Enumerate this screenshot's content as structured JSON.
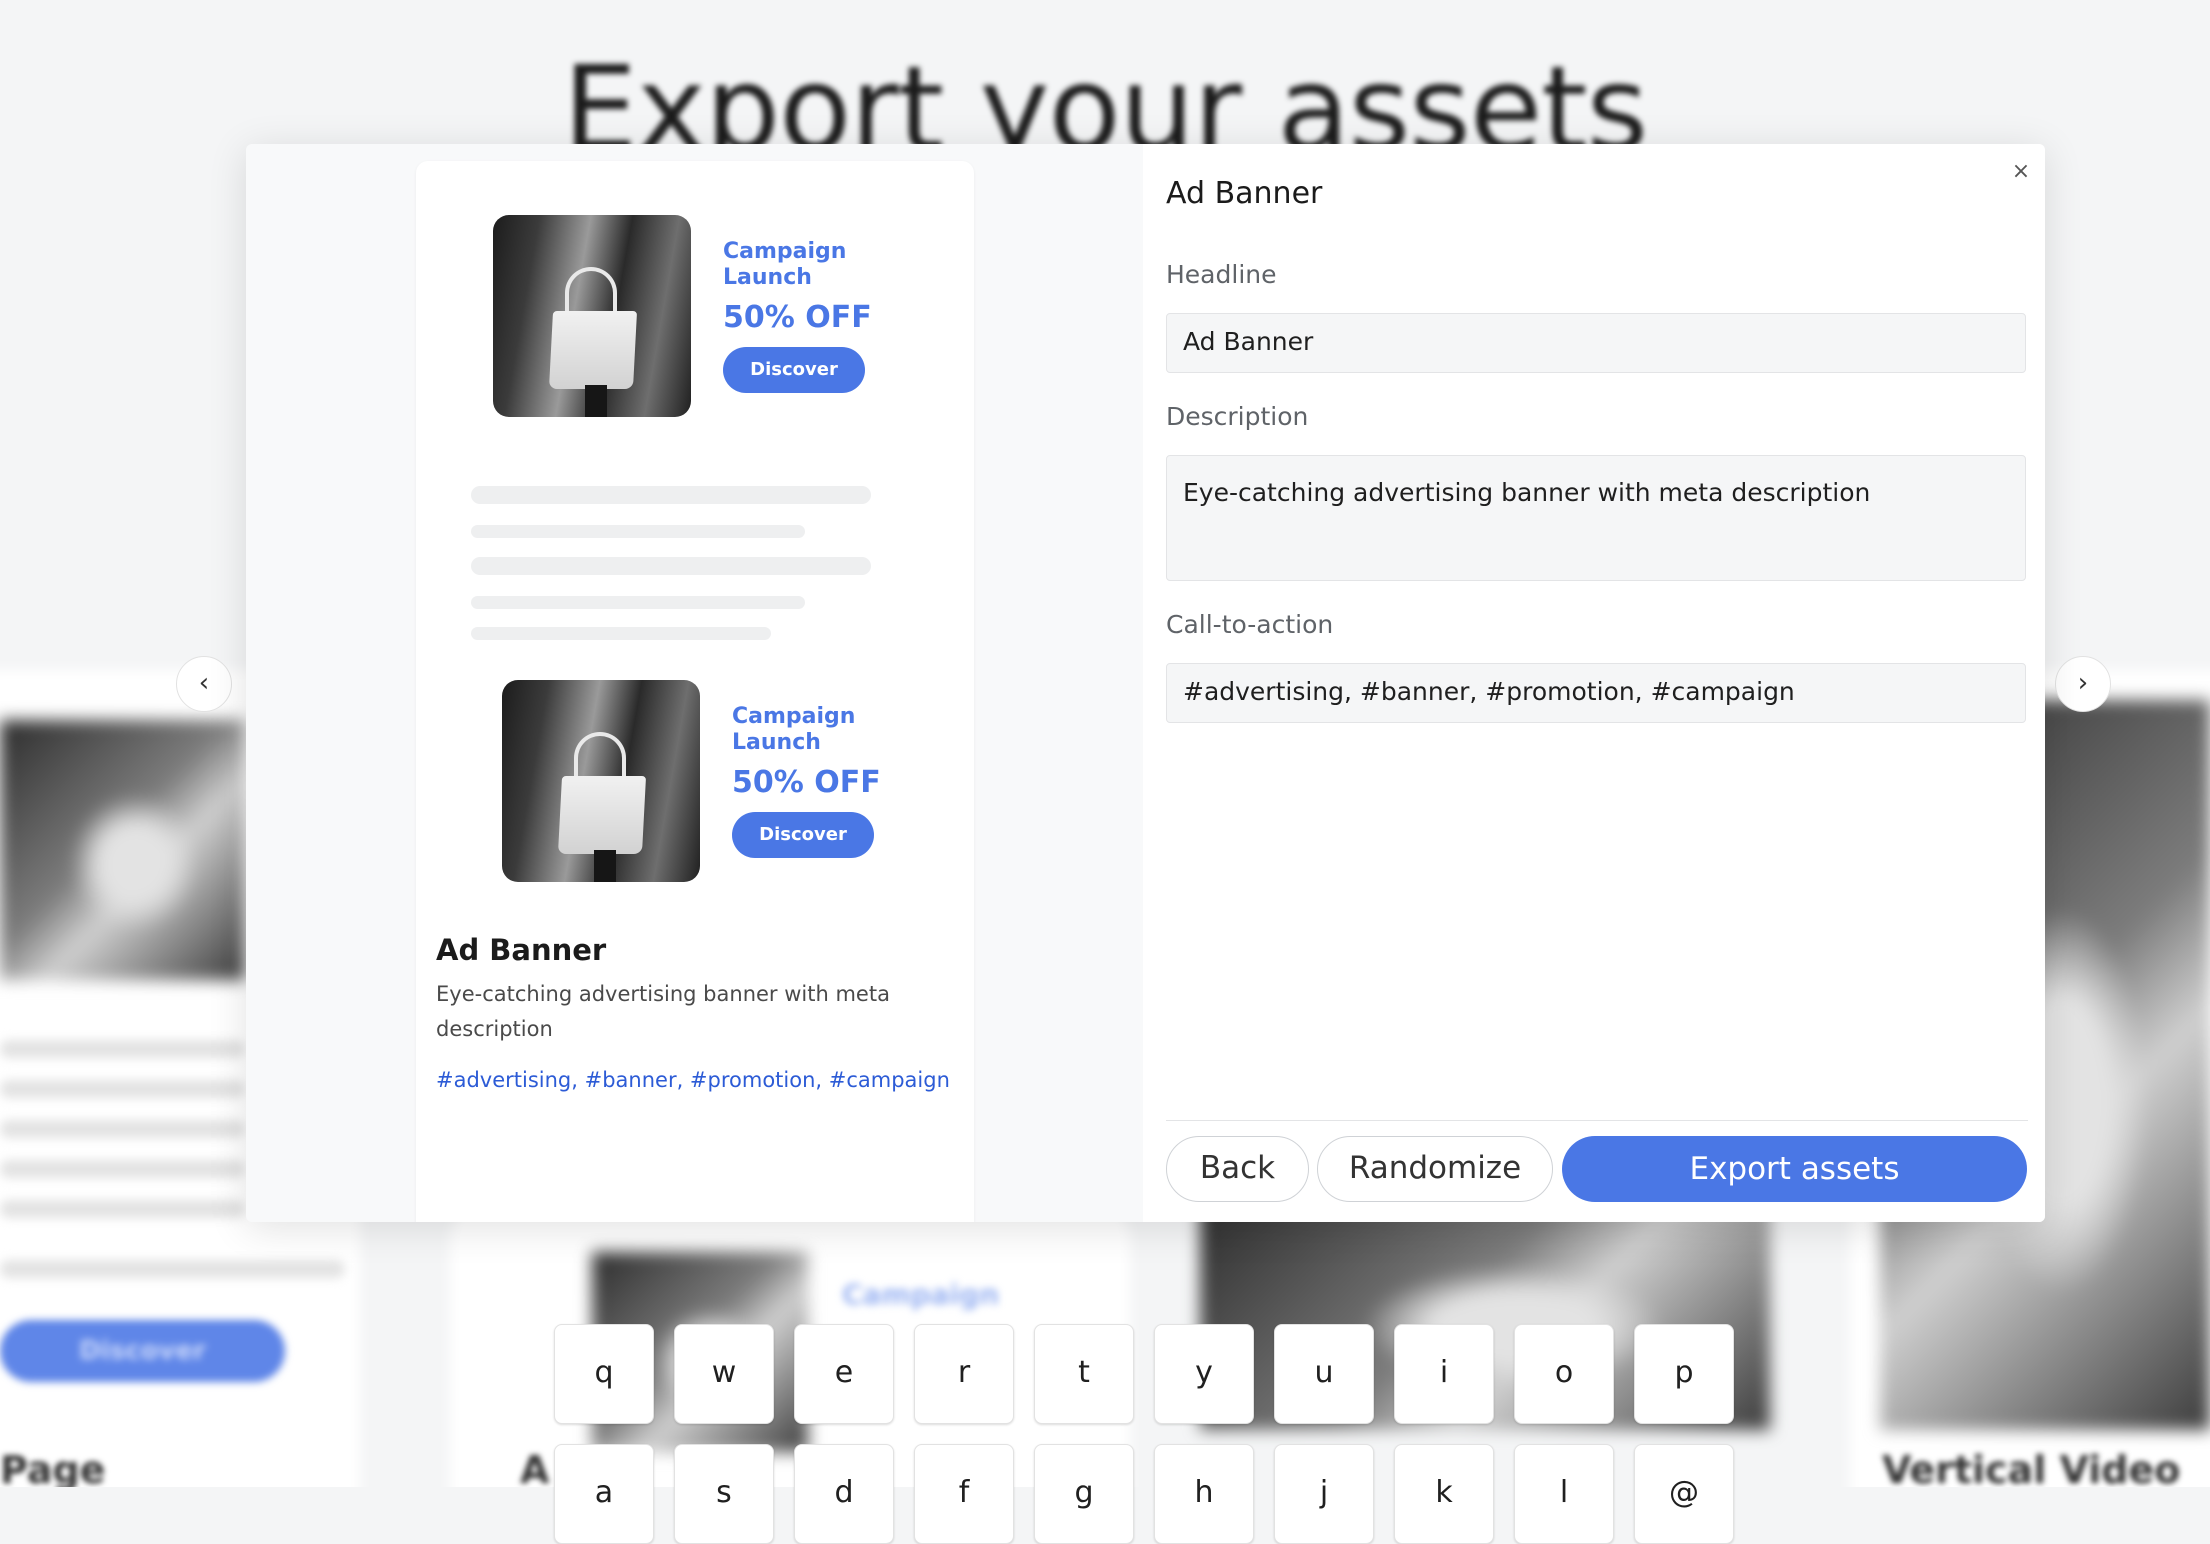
{
  "background": {
    "page_title": "Export your assets",
    "left_card": {
      "cta_label": "Discover",
      "title_fragment": "Page"
    },
    "middle_card": {
      "kicker": "Campaign",
      "title_fragment": "A"
    },
    "right_card": {
      "title": "Vertical Video"
    }
  },
  "modal": {
    "close_icon": "×",
    "prev_icon": "‹",
    "next_icon": "›",
    "preview": {
      "ads": [
        {
          "kicker": "Campaign Launch",
          "offer": "50% OFF",
          "cta": "Discover"
        },
        {
          "kicker": "Campaign Launch",
          "offer": "50% OFF",
          "cta": "Discover"
        }
      ],
      "title": "Ad Banner",
      "description": "Eye-catching advertising banner with meta description",
      "tags": "#advertising, #banner, #promotion, #campaign"
    },
    "form": {
      "title": "Ad Banner",
      "headline_label": "Headline",
      "headline_value": "Ad Banner",
      "description_label": "Description",
      "description_value": "Eye-catching advertising banner with meta description",
      "cta_label": "Call-to-action",
      "cta_value": "#advertising, #banner, #promotion, #campaign"
    },
    "actions": {
      "back": "Back",
      "randomize": "Randomize",
      "export": "Export assets"
    }
  },
  "keyboard": {
    "row1": [
      "q",
      "w",
      "e",
      "r",
      "t",
      "y",
      "u",
      "i",
      "o",
      "p"
    ],
    "row2": [
      "a",
      "s",
      "d",
      "f",
      "g",
      "h",
      "j",
      "k",
      "l",
      "@"
    ]
  },
  "colors": {
    "accent": "#4a77e5",
    "tag_blue": "#2c5bd6",
    "modal_bg": "#f8f9fa"
  }
}
